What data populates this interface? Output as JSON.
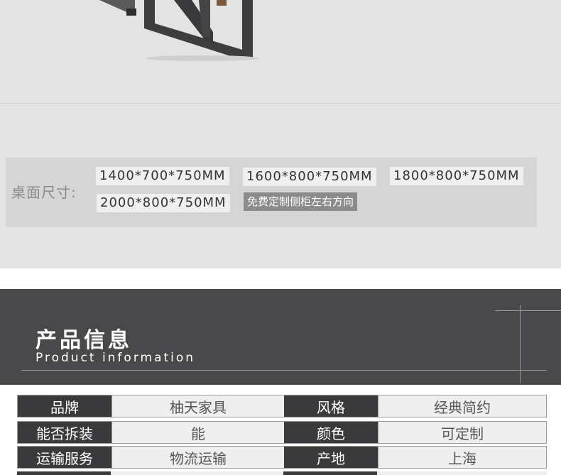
{
  "colors": {
    "photo_bg": "#e3e3e3",
    "header_bg": "#49494b",
    "key_cell_bg": "#3a3a3c",
    "value_cell_bg": "#eeeeee",
    "chip_bg": "#efefef",
    "chip_dark_bg": "#8b8b8b"
  },
  "size": {
    "label": "桌面尺寸:",
    "options": [
      "1400*700*750MM",
      "1600*800*750MM",
      "1800*800*750MM",
      "2000*800*750MM"
    ],
    "custom_note": "免费定制侧柜左右方向"
  },
  "info": {
    "title": "产品信息",
    "subtitle": "Product information"
  },
  "specs": [
    {
      "k1": "品牌",
      "v1": "柚天家具",
      "k2": "风格",
      "v2": "经典简约"
    },
    {
      "k1": "能否拆装",
      "v1": "能",
      "k2": "颜色",
      "v2": "可定制"
    },
    {
      "k1": "运输服务",
      "v1": "物流运输",
      "k2": "产地",
      "v2": "上海"
    }
  ]
}
